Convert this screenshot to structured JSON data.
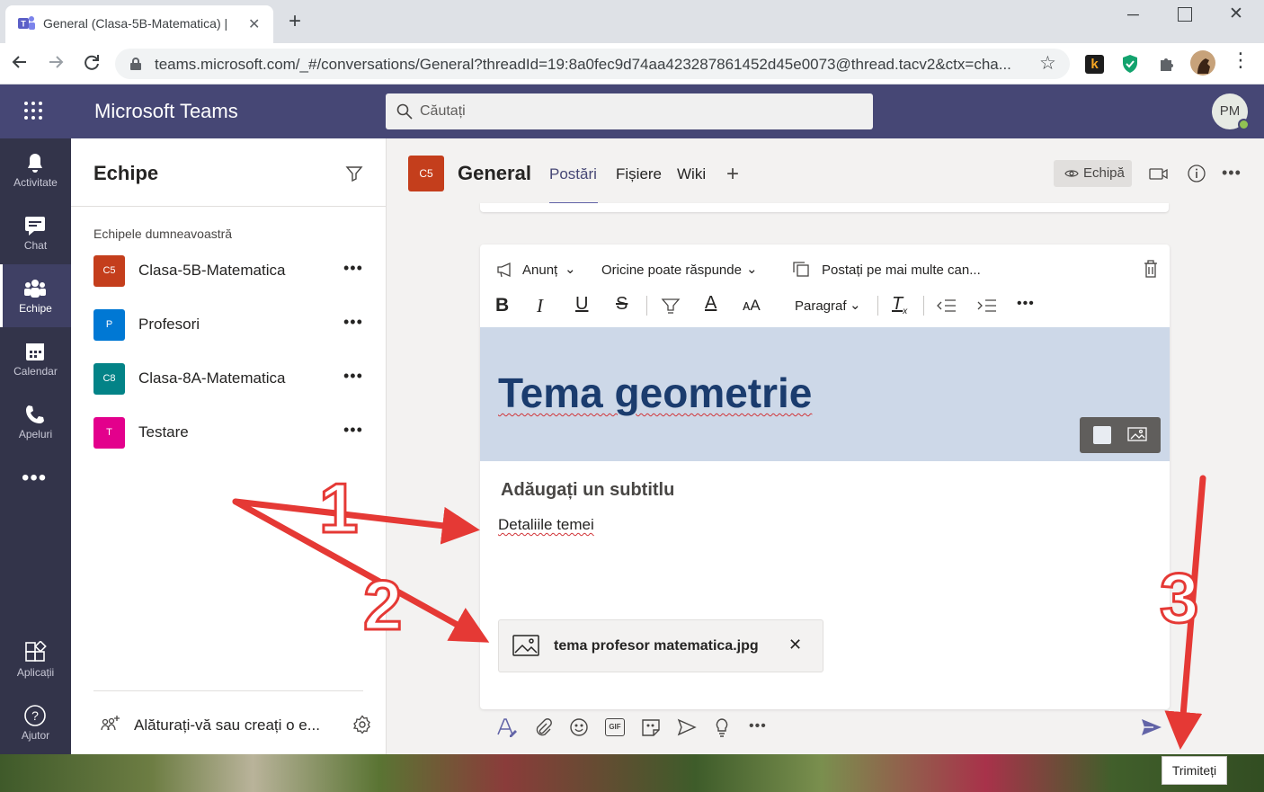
{
  "browser": {
    "tab_title": "General (Clasa-5B-Matematica) |",
    "url": "teams.microsoft.com/_#/conversations/General?threadId=19:8a0fec9d74aa423287861452d45e0073@thread.tacv2&ctx=cha..."
  },
  "app": {
    "title": "Microsoft Teams",
    "search_placeholder": "Căutați",
    "avatar_initials": "PM"
  },
  "rail": {
    "items": [
      {
        "label": "Activitate",
        "icon": "bell-icon"
      },
      {
        "label": "Chat",
        "icon": "chat-icon"
      },
      {
        "label": "Echipe",
        "icon": "teams-icon"
      },
      {
        "label": "Calendar",
        "icon": "calendar-icon"
      },
      {
        "label": "Apeluri",
        "icon": "phone-icon"
      },
      {
        "label": "Aplicații",
        "icon": "apps-icon"
      },
      {
        "label": "Ajutor",
        "icon": "help-icon"
      }
    ]
  },
  "panel": {
    "title": "Echipe",
    "section_label": "Echipele dumneavoastră",
    "teams": [
      {
        "initials": "C5",
        "name": "Clasa-5B-Matematica",
        "color": "#c43e1c"
      },
      {
        "initials": "P",
        "name": "Profesori",
        "color": "#0078d4"
      },
      {
        "initials": "C8",
        "name": "Clasa-8A-Matematica",
        "color": "#038387"
      },
      {
        "initials": "T",
        "name": "Testare",
        "color": "#e3008c"
      }
    ],
    "join_label": "Alăturați-vă sau creați o e..."
  },
  "channel": {
    "initials": "C5",
    "name": "General",
    "tabs": [
      "Postări",
      "Fișiere",
      "Wiki"
    ],
    "team_button": "Echipă"
  },
  "compose": {
    "post_type": "Anunț",
    "reply_setting": "Oricine poate răspunde",
    "multi_post": "Postați pe mai multe can...",
    "paragraph": "Paragraf",
    "title": "Tema geometrie",
    "subtitle": "Adăugați un subtitlu",
    "body": "Detaliile temei",
    "attachment_name": "tema profesor matematica.jpg",
    "send_tooltip": "Trimiteți"
  },
  "annotations": [
    "1",
    "2",
    "3"
  ],
  "colors": {
    "teams_purple": "#464775",
    "rail_bg": "#33344a",
    "accent": "#6264a7",
    "annotation_red": "#e53935"
  }
}
